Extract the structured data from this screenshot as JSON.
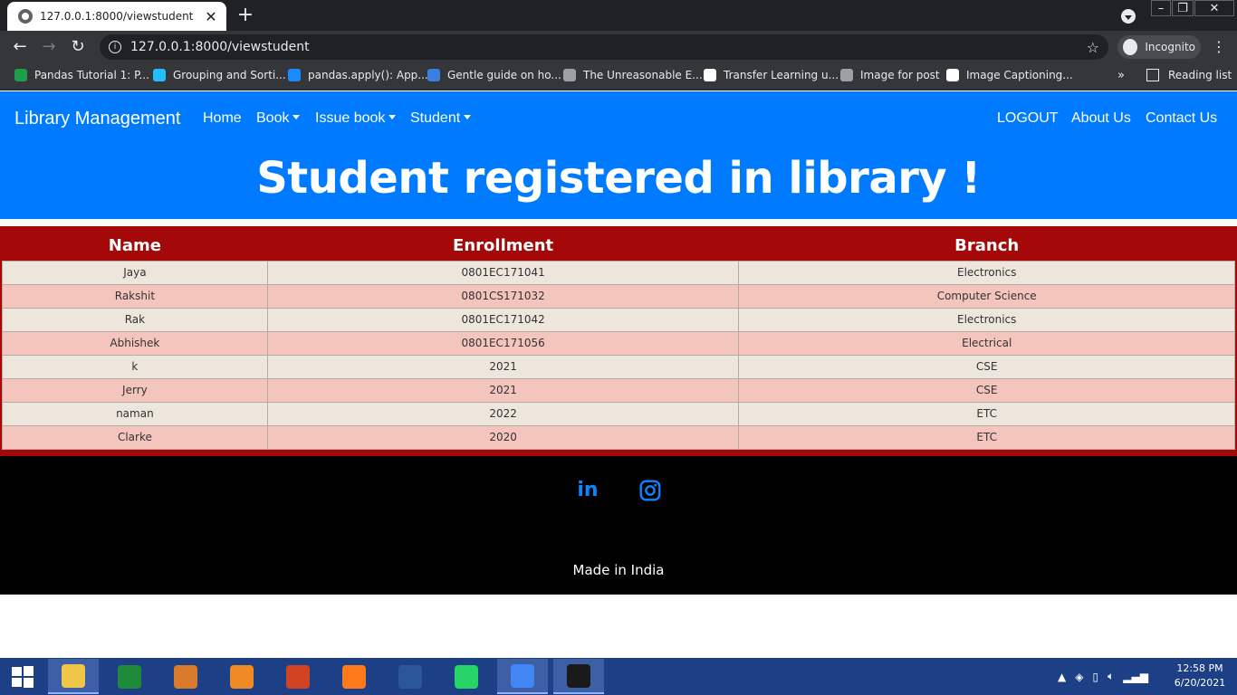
{
  "browser": {
    "tab_title": "127.0.0.1:8000/viewstudent",
    "tab_close": "✕",
    "new_tab": "+",
    "url": "127.0.0.1:8000/viewstudent",
    "profile_label": "Incognito",
    "bookmarks": [
      {
        "label": "Pandas Tutorial 1: P...",
        "color": "#1e9e4a"
      },
      {
        "label": "Grouping and Sorti...",
        "color": "#20beff"
      },
      {
        "label": "pandas.apply(): App...",
        "color": "#1a8cff"
      },
      {
        "label": "Gentle guide on ho...",
        "color": "#3b7ee0"
      },
      {
        "label": "The Unreasonable E...",
        "color": "#9aa0a6"
      },
      {
        "label": "Transfer Learning u...",
        "color": "#ffffff"
      },
      {
        "label": "Image for post",
        "color": "#9aa0a6"
      },
      {
        "label": "Image Captioning...",
        "color": "#ffffff"
      }
    ],
    "bookmarks_more": "»",
    "reading_list": "Reading list"
  },
  "navbar": {
    "brand": "Library Management",
    "links": {
      "home": "Home",
      "book": "Book",
      "issue_book": "Issue book",
      "student": "Student",
      "logout": "LOGOUT",
      "about": "About Us",
      "contact": "Contact Us"
    },
    "color": "#007bff"
  },
  "heading": "Student registered in library !",
  "table": {
    "headers": [
      "Name",
      "Enrollment",
      "Branch"
    ],
    "rows": [
      [
        "Jaya",
        "0801EC171041",
        "Electronics"
      ],
      [
        "Rakshit",
        "0801CS171032",
        "Computer Science"
      ],
      [
        "Rak",
        "0801EC171042",
        "Electronics"
      ],
      [
        "Abhishek",
        "0801EC171056",
        "Electrical"
      ],
      [
        "k",
        "2021",
        "CSE"
      ],
      [
        "Jerry",
        "2021",
        "CSE"
      ],
      [
        "naman",
        "2022",
        "ETC"
      ],
      [
        "Clarke",
        "2020",
        "ETC"
      ]
    ],
    "header_color": "#a50808"
  },
  "footer": {
    "social_icons": [
      "linkedin-icon",
      "instagram-icon"
    ],
    "linkedin_text": "in",
    "made_in": "Made in India"
  },
  "taskbar": {
    "apps": [
      {
        "name": "file-explorer-icon",
        "color": "#f0c64a",
        "active": true
      },
      {
        "name": "store-icon",
        "color": "#1e8a3a",
        "active": false
      },
      {
        "name": "media-app-icon",
        "color": "#d97a2b",
        "active": false
      },
      {
        "name": "sublime-text-icon",
        "color": "#f08a24",
        "active": false
      },
      {
        "name": "powerpoint-icon",
        "color": "#d04423",
        "active": false
      },
      {
        "name": "firefox-icon",
        "color": "#ff7a1a",
        "active": false
      },
      {
        "name": "word-icon",
        "color": "#2b579a",
        "active": false
      },
      {
        "name": "whatsapp-icon",
        "color": "#25d366",
        "active": false
      },
      {
        "name": "chrome-icon",
        "color": "#4285f4",
        "active": true
      },
      {
        "name": "terminal-icon",
        "color": "#1a1a1a",
        "active": true
      }
    ],
    "time": "12:58 PM",
    "date": "6/20/2021"
  }
}
